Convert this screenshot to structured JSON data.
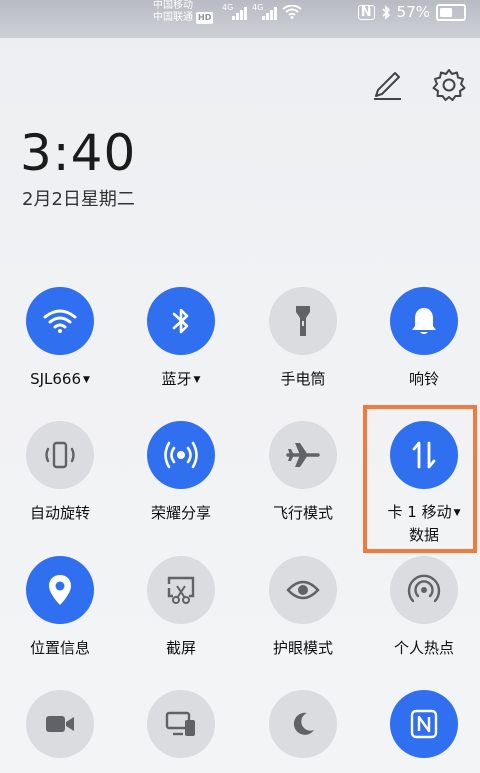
{
  "status_bar": {
    "carrier1": "中国移动",
    "carrier2": "中国联通",
    "hd_badge": "HD",
    "net1": "4G",
    "net2": "4G",
    "battery_pct": "57%",
    "battery_fraction": 0.57
  },
  "header": {
    "time": "3:40",
    "date": "2月2日星期二"
  },
  "tiles": [
    {
      "label": "SJL666",
      "dropdown": true,
      "on": true,
      "icon": "wifi-icon"
    },
    {
      "label": "蓝牙",
      "dropdown": true,
      "on": true,
      "icon": "bluetooth-icon"
    },
    {
      "label": "手电筒",
      "dropdown": false,
      "on": false,
      "icon": "flashlight-icon"
    },
    {
      "label": "响铃",
      "dropdown": false,
      "on": true,
      "icon": "bell-icon"
    },
    {
      "label": "自动旋转",
      "dropdown": false,
      "on": false,
      "icon": "auto-rotate-icon"
    },
    {
      "label": "荣耀分享",
      "dropdown": false,
      "on": true,
      "icon": "share-icon"
    },
    {
      "label": "飞行模式",
      "dropdown": false,
      "on": false,
      "icon": "airplane-icon"
    },
    {
      "label_line1": "卡 1 移动",
      "label_line2": "数据",
      "dropdown": true,
      "on": true,
      "icon": "mobile-data-icon"
    },
    {
      "label": "位置信息",
      "dropdown": false,
      "on": true,
      "icon": "location-icon"
    },
    {
      "label": "截屏",
      "dropdown": false,
      "on": false,
      "icon": "screenshot-icon"
    },
    {
      "label": "护眼模式",
      "dropdown": false,
      "on": false,
      "icon": "eye-icon"
    },
    {
      "label": "个人热点",
      "dropdown": false,
      "on": false,
      "icon": "hotspot-icon"
    }
  ],
  "colors": {
    "accent": "#2f6ff0",
    "off": "#dadcdf",
    "highlight": "#f07b3f"
  }
}
